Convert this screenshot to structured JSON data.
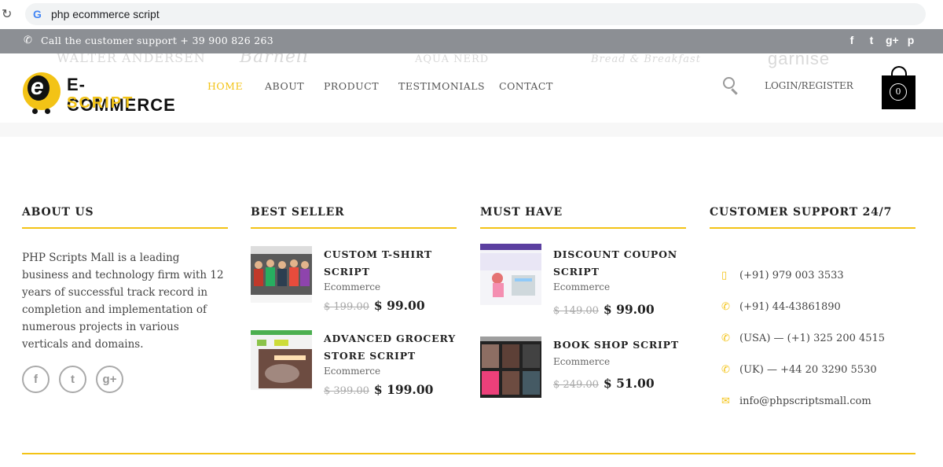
{
  "browser": {
    "query": "php ecommerce script",
    "google_glyph": "G",
    "reload_icon": "reload-icon"
  },
  "topbar": {
    "support_text": "Call the customer support + 39 900 826 263",
    "social": [
      "f",
      "t",
      "g+",
      "p"
    ]
  },
  "brands": [
    "WALTER ANDERSEN",
    "Barneli",
    "AQUA NERD",
    "Bread & Breakfast",
    "garnise"
  ],
  "logo": {
    "line1": "E-COMMERCE",
    "line2": "SCRIPT",
    "glyph": "e"
  },
  "nav": {
    "items": [
      "HOME",
      "ABOUT",
      "PRODUCT",
      "TESTIMONIALS",
      "CONTACT"
    ],
    "login": "LOGIN/REGISTER",
    "cart_count": "0"
  },
  "about": {
    "title": "ABOUT US",
    "text": "PHP Scripts Mall is a leading business and technology firm with 12 years of successful track record in completion and implementation of numerous projects in various verticals and domains.",
    "social": [
      "f",
      "t",
      "g+"
    ]
  },
  "best_seller": {
    "title": "BEST SELLER",
    "products": [
      {
        "title": "CUSTOM T-SHIRT SCRIPT",
        "category": "Ecommerce",
        "old_price": "$ 199.00",
        "price": "$ 99.00"
      },
      {
        "title": "ADVANCED GROCERY STORE SCRIPT",
        "category": "Ecommerce",
        "old_price": "$ 399.00",
        "price": "$ 199.00"
      }
    ]
  },
  "must_have": {
    "title": "MUST HAVE",
    "products": [
      {
        "title": "DISCOUNT COUPON SCRIPT",
        "category": "Ecommerce",
        "old_price": "$ 149.00",
        "price": "$ 99.00"
      },
      {
        "title": "BOOK SHOP SCRIPT",
        "category": "Ecommerce",
        "old_price": "$ 249.00",
        "price": "$ 51.00"
      }
    ]
  },
  "support": {
    "title": "CUSTOMER SUPPORT 24/7",
    "items": [
      {
        "icon": "mobile-icon",
        "text": "(+91) 979 003 3533"
      },
      {
        "icon": "phone-icon",
        "text": "(+91) 44-43861890"
      },
      {
        "icon": "phone-icon",
        "text": "(USA) — (+1) 325 200 4515"
      },
      {
        "icon": "phone-icon",
        "text": "(UK) — +44 20 3290 5530"
      },
      {
        "icon": "envelope-icon",
        "text": "info@phpscriptsmall.com"
      }
    ]
  },
  "colors": {
    "accent": "#f3c316",
    "topbar": "#8c8f94",
    "text": "#444444"
  }
}
